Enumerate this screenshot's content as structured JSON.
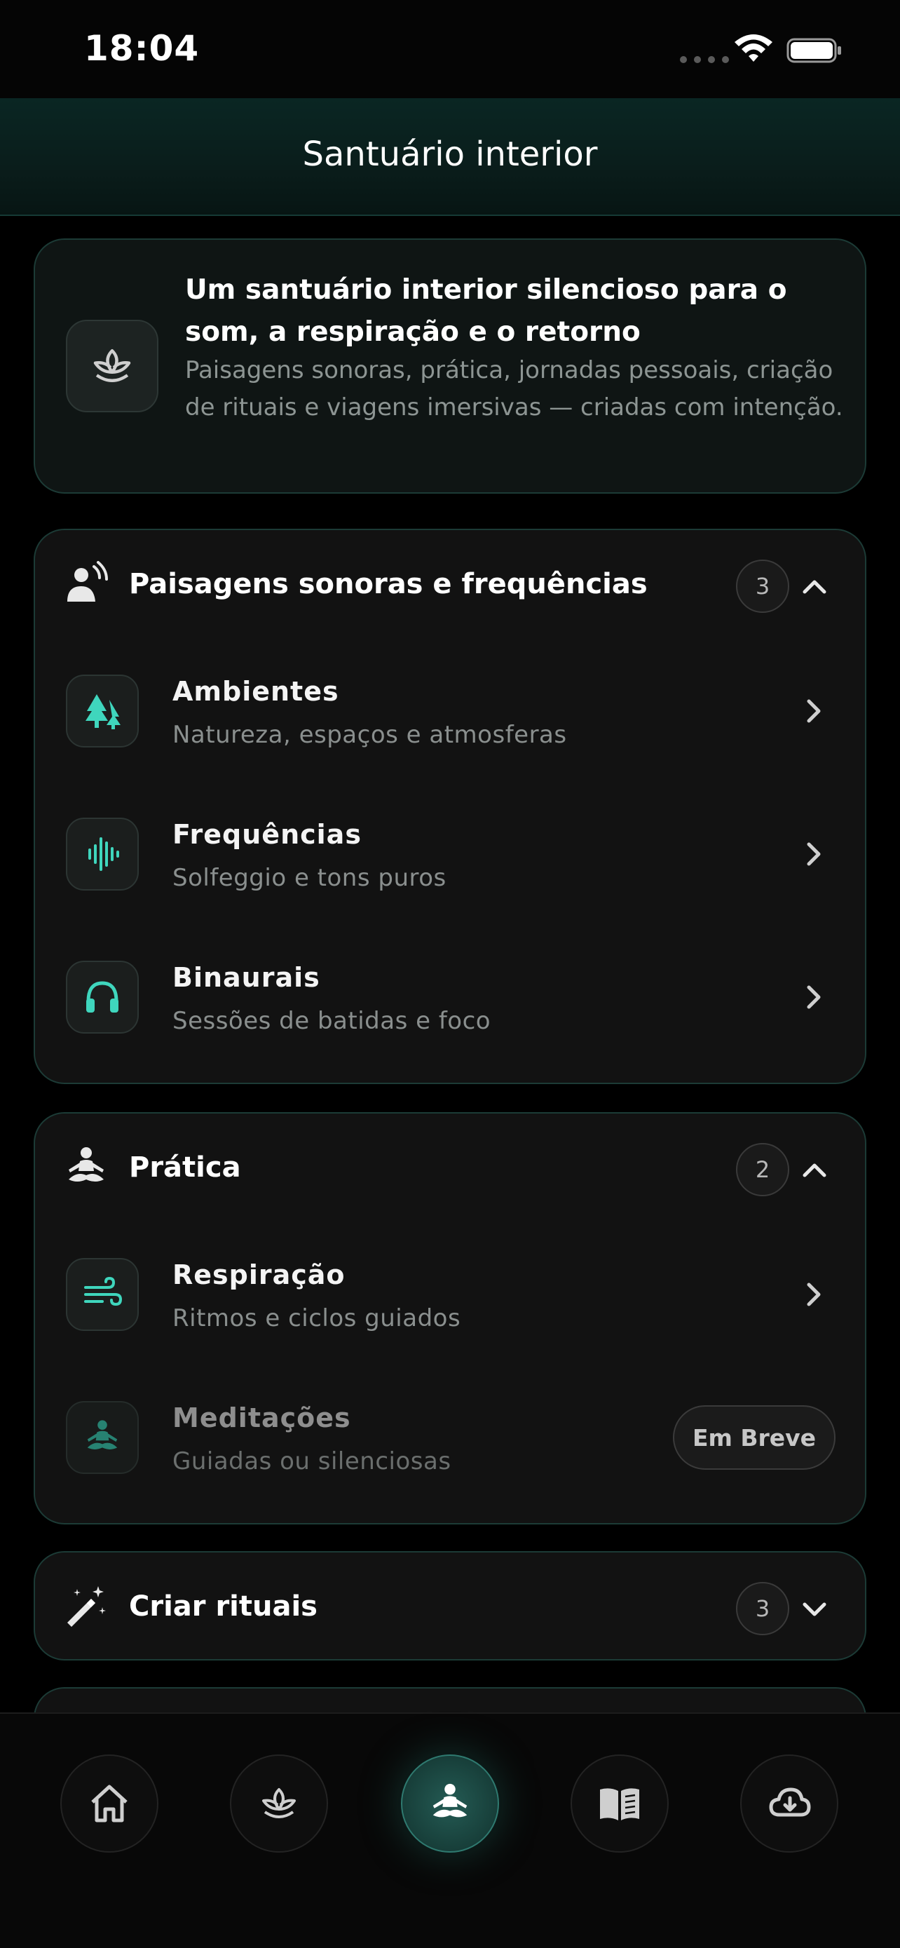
{
  "status": {
    "time": "18:04"
  },
  "header": {
    "title": "Santuário interior"
  },
  "intro": {
    "title": "Um santuário interior silencioso para o som, a respiração e o retorno",
    "description": "Paisagens sonoras, prática, jornadas pessoais, criação de rituais e viagens imersivas — criadas com intenção.",
    "icon": "lotus-icon"
  },
  "sections": {
    "sound": {
      "title": "Paisagens sonoras e frequências",
      "count": "3",
      "icon": "person-sound-icon",
      "items": [
        {
          "title": "Ambientes",
          "subtitle": "Natureza, espaços e atmosferas",
          "icon": "trees-icon"
        },
        {
          "title": "Frequências",
          "subtitle": "Solfeggio e tons puros",
          "icon": "waveform-icon"
        },
        {
          "title": "Binaurais",
          "subtitle": "Sessões de batidas e foco",
          "icon": "headphones-icon"
        }
      ]
    },
    "practice": {
      "title": "Prática",
      "count": "2",
      "icon": "meditation-icon",
      "items": [
        {
          "title": "Respiração",
          "subtitle": "Ritmos e ciclos guiados",
          "icon": "wind-icon"
        },
        {
          "title": "Meditações",
          "subtitle": "Guiadas ou silenciosas",
          "icon": "meditation-icon",
          "badge": "Em Breve"
        }
      ]
    },
    "rituals": {
      "title": "Criar rituais",
      "count": "3",
      "icon": "magic-wand-icon"
    }
  },
  "nav": [
    {
      "name": "home-icon",
      "active": false
    },
    {
      "name": "lotus-icon",
      "active": false
    },
    {
      "name": "meditation-icon",
      "active": true
    },
    {
      "name": "book-icon",
      "active": false
    },
    {
      "name": "cloud-download-icon",
      "active": false
    }
  ],
  "colors": {
    "accent": "#3fd6bd",
    "card_border": "#1c3b36",
    "background": "#000000"
  }
}
